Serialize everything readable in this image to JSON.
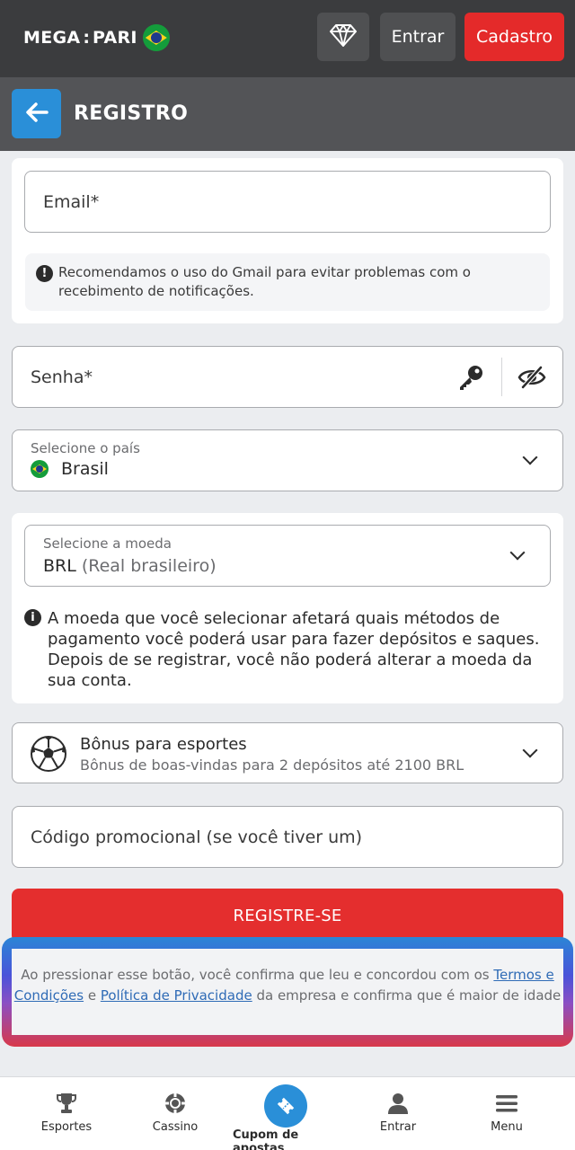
{
  "header": {
    "logo_left": "MEGA",
    "logo_colon": ":",
    "logo_right": "PARI",
    "vip_icon": "diamond-icon",
    "login_label": "Entrar",
    "signup_label": "Cadastro"
  },
  "subheader": {
    "back_icon": "arrow-left-icon",
    "title": "REGISTRO"
  },
  "email": {
    "placeholder": "Email*",
    "notice": "Recomendamos o uso do Gmail para evitar problemas com o recebimento de notificações."
  },
  "password": {
    "placeholder": "Senha*",
    "key_icon": "key-icon",
    "visibility_icon": "eye-slash-icon"
  },
  "country": {
    "label": "Selecione o país",
    "value": "Brasil"
  },
  "currency": {
    "label": "Selecione a moeda",
    "code": "BRL",
    "name": "(Real brasileiro)",
    "note": "A moeda que você selecionar afetará quais métodos de pagamento você poderá usar para fazer depósitos e saques. Depois de se registrar, você não poderá alterar a moeda da sua conta."
  },
  "bonus": {
    "title": "Bônus para esportes",
    "subtitle": "Bônus de boas-vindas para 2 depósitos até 2100 BRL",
    "icon": "soccer-ball-icon"
  },
  "promo": {
    "placeholder": "Código promocional (se você tiver um)"
  },
  "register_button": "REGISTRE-SE",
  "terms": {
    "prefix": "Ao pressionar esse botão, você confirma que leu e concordou com os ",
    "terms_link": "Termos e Condições",
    "middle": " e ",
    "privacy_link": "Política de Privacidade",
    "suffix": " da empresa e confirma que é maior de idade"
  },
  "bottom_nav": {
    "sports": "Esportes",
    "casino": "Cassino",
    "coupon": "Cupom de apostas",
    "login": "Entrar",
    "menu": "Menu"
  },
  "colors": {
    "header_bg": "#3b3c3e",
    "subheader_bg": "#535457",
    "accent_blue": "#2a8fd8",
    "accent_red": "#e42a2a",
    "page_bg": "#ebedf0"
  }
}
